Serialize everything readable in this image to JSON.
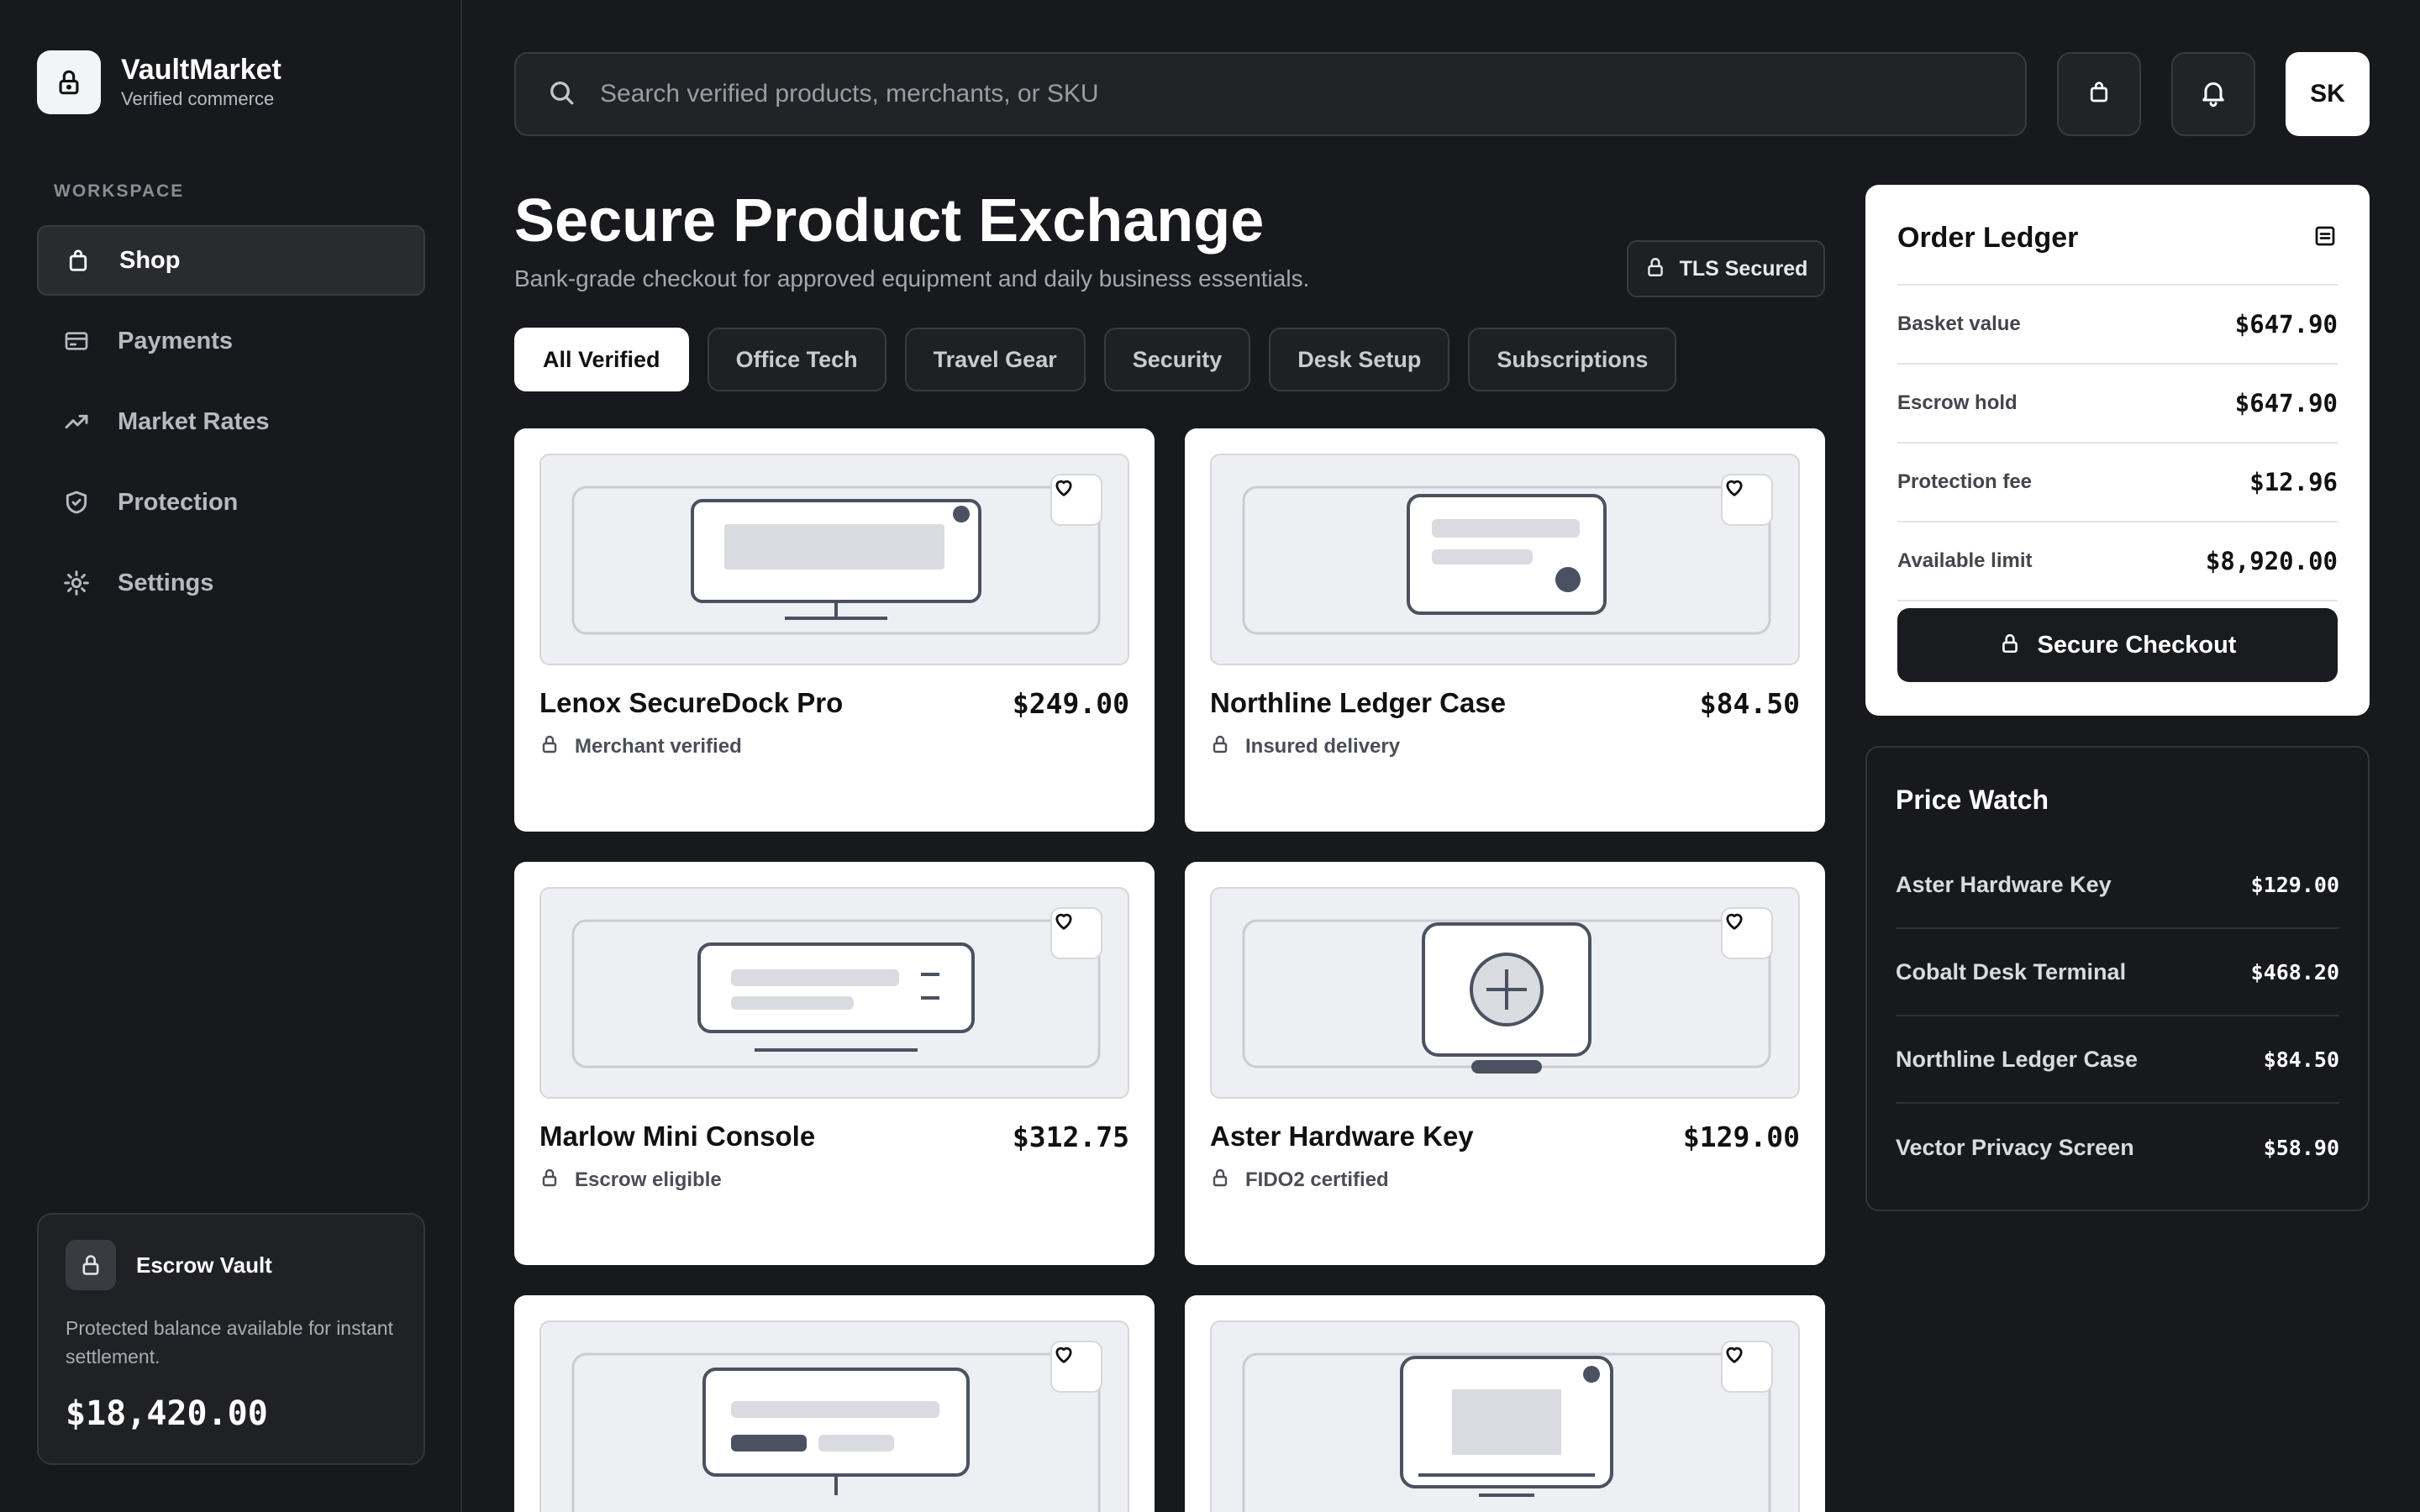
{
  "brand": {
    "name": "VaultMarket",
    "subtitle": "Verified commerce",
    "logo_icon": "lock-icon"
  },
  "sidebar": {
    "section_label": "WORKSPACE",
    "items": [
      {
        "label": "Shop",
        "icon": "bag-icon",
        "active": true
      },
      {
        "label": "Payments",
        "icon": "card-icon",
        "active": false
      },
      {
        "label": "Market Rates",
        "icon": "trend-icon",
        "active": false
      },
      {
        "label": "Protection",
        "icon": "shield-icon",
        "active": false
      },
      {
        "label": "Settings",
        "icon": "gear-icon",
        "active": false
      }
    ],
    "vault": {
      "title": "Escrow Vault",
      "description": "Protected balance available for instant settlement.",
      "amount": "$18,420.00"
    }
  },
  "topbar": {
    "search_placeholder": "Search verified products, merchants, or SKU",
    "avatar_initials": "SK"
  },
  "header": {
    "title": "Secure Product Exchange",
    "subtitle": "Bank-grade checkout for approved equipment and daily business essentials.",
    "security_badge": "TLS Secured"
  },
  "filters": [
    "All Verified",
    "Office Tech",
    "Travel Gear",
    "Security",
    "Desk Setup",
    "Subscriptions"
  ],
  "products": [
    {
      "name": "Lenox SecureDock Pro",
      "price": "$249.00",
      "badge": "Merchant verified"
    },
    {
      "name": "Northline Ledger Case",
      "price": "$84.50",
      "badge": "Insured delivery"
    },
    {
      "name": "Marlow Mini Console",
      "price": "$312.75",
      "badge": "Escrow eligible"
    },
    {
      "name": "Aster Hardware Key",
      "price": "$129.00",
      "badge": "FIDO2 certified"
    }
  ],
  "ledger": {
    "title": "Order Ledger",
    "rows": [
      {
        "label": "Basket value",
        "value": "$647.90"
      },
      {
        "label": "Escrow hold",
        "value": "$647.90"
      },
      {
        "label": "Protection fee",
        "value": "$12.96"
      },
      {
        "label": "Available limit",
        "value": "$8,920.00"
      }
    ],
    "checkout_label": "Secure Checkout"
  },
  "price_watch": {
    "title": "Price Watch",
    "items": [
      {
        "name": "Aster Hardware Key",
        "price": "$129.00"
      },
      {
        "name": "Cobalt Desk Terminal",
        "price": "$468.20"
      },
      {
        "name": "Northline Ledger Case",
        "price": "$84.50"
      },
      {
        "name": "Vector Privacy Screen",
        "price": "$58.90"
      }
    ]
  },
  "colors": {
    "background": "#18191c",
    "panel": "#202124",
    "card": "#ffffff",
    "accent_dark": "#1a1b1e",
    "muted_text": "#a4a7ae"
  }
}
